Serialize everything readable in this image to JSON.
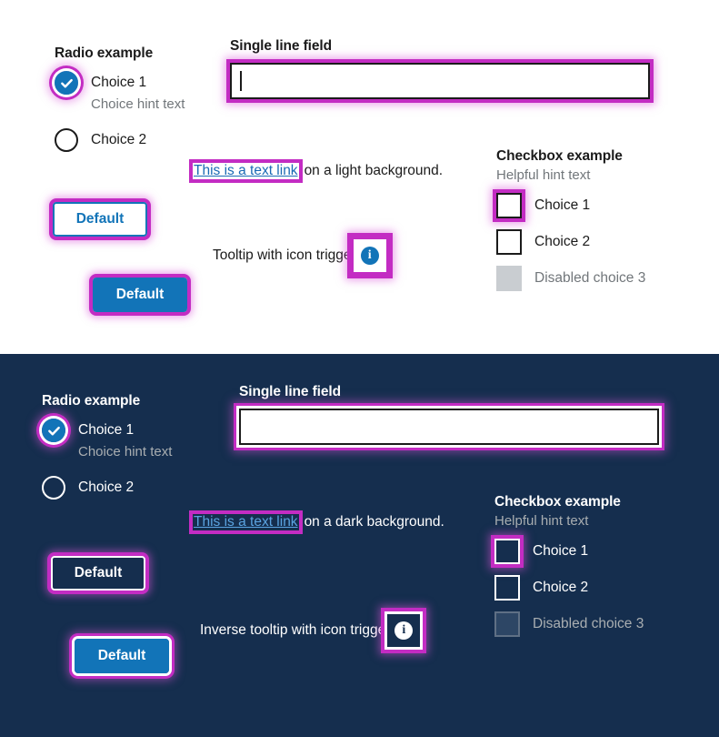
{
  "theme": {
    "light_background": "#ffffff",
    "dark_background": "#152e4e",
    "accent_blue": "#1274b8",
    "focus_magenta": "#c32cc3",
    "link_blue_light": "#1a6bb5",
    "link_blue_dark": "#5aa3e0",
    "hint_gray_light": "#71767a",
    "hint_gray_dark": "#a9aeb1",
    "disabled_fill_light": "#c9cdd1",
    "disabled_fill_dark": "#2d4665"
  },
  "light_section": {
    "radio_group": {
      "legend": "Radio example",
      "options": [
        {
          "label": "Choice 1",
          "hint": "Choice hint text",
          "checked": true,
          "focused": true
        },
        {
          "label": "Choice 2",
          "hint": "",
          "checked": false,
          "focused": false
        }
      ]
    },
    "text_field": {
      "label": "Single line field",
      "value": "",
      "placeholder": ""
    },
    "link_line": {
      "link_text": "This is a text link",
      "trailing_text": "on a light background."
    },
    "tooltip": {
      "label": "Tooltip with icon trigger",
      "icon": "info-icon"
    },
    "buttons": [
      {
        "label": "Default",
        "style": "outline"
      },
      {
        "label": "Default",
        "style": "solid"
      }
    ],
    "checkbox_group": {
      "legend": "Checkbox example",
      "hint": "Helpful hint text",
      "options": [
        {
          "label": "Choice 1",
          "checked": false,
          "disabled": false,
          "focused": true
        },
        {
          "label": "Choice 2",
          "checked": false,
          "disabled": false,
          "focused": false
        },
        {
          "label": "Disabled choice 3",
          "checked": false,
          "disabled": true,
          "focused": false
        }
      ]
    }
  },
  "dark_section": {
    "radio_group": {
      "legend": "Radio example",
      "options": [
        {
          "label": "Choice 1",
          "hint": "Choice hint text",
          "checked": true,
          "focused": true
        },
        {
          "label": "Choice 2",
          "hint": "",
          "checked": false,
          "focused": false
        }
      ]
    },
    "text_field": {
      "label": "Single line field",
      "value": "",
      "placeholder": ""
    },
    "link_line": {
      "link_text": "This is a text link",
      "trailing_text": "on a dark background."
    },
    "tooltip": {
      "label": "Inverse tooltip with icon trigger",
      "icon": "info-icon"
    },
    "buttons": [
      {
        "label": "Default",
        "style": "outline"
      },
      {
        "label": "Default",
        "style": "solid"
      }
    ],
    "checkbox_group": {
      "legend": "Checkbox example",
      "hint": "Helpful hint text",
      "options": [
        {
          "label": "Choice 1",
          "checked": false,
          "disabled": false,
          "focused": true
        },
        {
          "label": "Choice 2",
          "checked": false,
          "disabled": false,
          "focused": false
        },
        {
          "label": "Disabled choice 3",
          "checked": false,
          "disabled": true,
          "focused": false
        }
      ]
    }
  }
}
